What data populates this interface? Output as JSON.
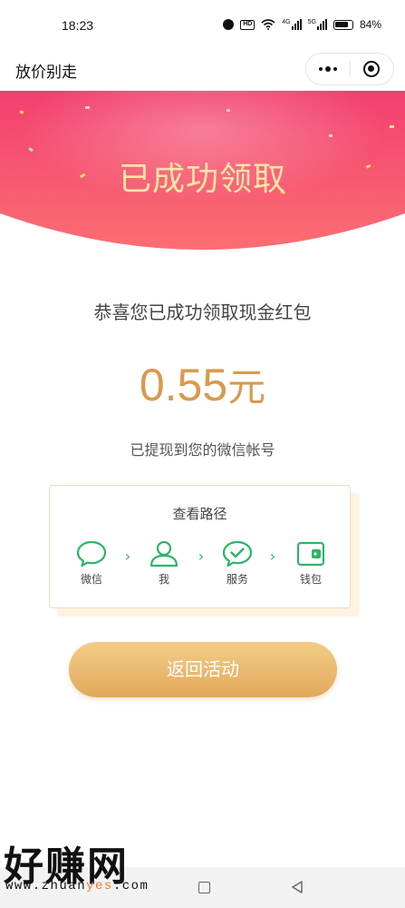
{
  "status_bar": {
    "time": "18:23",
    "network_1": "4G",
    "network_2": "5G",
    "battery": "84%"
  },
  "nav": {
    "title": "放价别走",
    "more_icon": "more-dots-icon",
    "close_icon": "target-close-icon"
  },
  "banner": {
    "title": "已成功领取",
    "color_top": "#f23f6f",
    "color_bottom": "#fb6e72"
  },
  "main": {
    "congrats": "恭喜您已成功领取现金红包",
    "amount_value": "0.55",
    "amount_unit": "元",
    "amount_color": "#d99a4f",
    "withdraw_note": "已提现到您的微信帐号"
  },
  "path_card": {
    "title": "查看路径",
    "steps": [
      {
        "label": "微信",
        "icon": "chat-bubble-icon"
      },
      {
        "label": "我",
        "icon": "person-icon"
      },
      {
        "label": "服务",
        "icon": "check-bubble-icon"
      },
      {
        "label": "钱包",
        "icon": "wallet-icon"
      }
    ],
    "separator": "›",
    "accent": "#2fb468"
  },
  "return_button": {
    "label": "返回活动"
  },
  "watermark": {
    "text": "好赚网",
    "url_prefix": "www.zhuan",
    "url_highlight": "yes",
    "url_suffix": ".com"
  }
}
